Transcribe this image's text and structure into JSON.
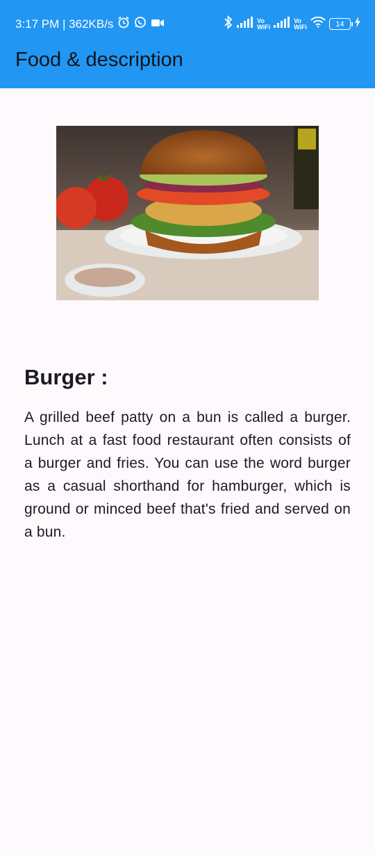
{
  "status_bar": {
    "time_speed": "3:17 PM | 362KB/s",
    "vo_label": "Vo",
    "wifi_label": "WiFi",
    "battery": "14"
  },
  "app_bar": {
    "title": "Food & description"
  },
  "food": {
    "name": "Burger :",
    "description": "A grilled beef patty on a bun is called a burger. Lunch at a fast food restaurant often consists of a burger and fries. You can use the word burger as a casual shorthand for hamburger, which is ground or minced beef that's fried and served on a bun."
  },
  "colors": {
    "app_bar": "#2196f3",
    "background": "#fdf9fd",
    "text": "#1c1b1f"
  },
  "icons": [
    "alarm-icon",
    "whatsapp-icon",
    "video-icon",
    "bluetooth-icon",
    "signal-icon",
    "wifi-icon",
    "battery-icon",
    "charging-icon"
  ]
}
